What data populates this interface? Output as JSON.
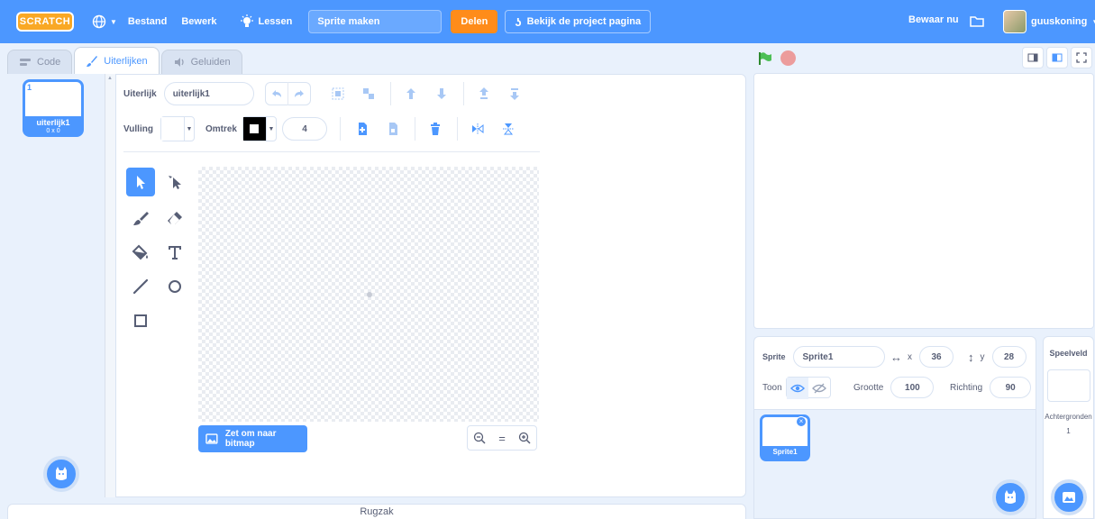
{
  "menubar": {
    "logo": "SCRATCH",
    "file_label": "Bestand",
    "edit_label": "Bewerk",
    "tutorials_label": "Lessen",
    "project_title": "Sprite maken",
    "share_label": "Delen",
    "project_page_label": "Bekijk de project pagina",
    "save_now_label": "Bewaar nu",
    "username": "guuskoning",
    "accent_color": "#4c97ff",
    "share_color": "#ff8c1a"
  },
  "tabs": [
    {
      "label": "Code",
      "icon": "code-icon"
    },
    {
      "label": "Uiterlijken",
      "icon": "brush-icon"
    },
    {
      "label": "Geluiden",
      "icon": "sound-icon"
    }
  ],
  "costumes": [
    {
      "index": "1",
      "name": "uiterlijk1",
      "size": "0 x 0"
    }
  ],
  "paint": {
    "costume_label": "Uiterlijk",
    "costume_name": "uiterlijk1",
    "fill_label": "Vulling",
    "stroke_label": "Omtrek",
    "stroke_width": "4",
    "fill_color": "#ffffff",
    "stroke_color": "#000000",
    "convert_label": "Zet om naar bitmap",
    "zoom_reset": "="
  },
  "backpack_label": "Rugzak",
  "sprite": {
    "sprite_label": "Sprite",
    "name": "Sprite1",
    "x_label": "x",
    "x": "36",
    "y_label": "y",
    "y": "28",
    "show_label": "Toon",
    "size_label": "Grootte",
    "size": "100",
    "direction_label": "Richting",
    "direction": "90"
  },
  "sprites": [
    {
      "name": "Sprite1"
    }
  ],
  "stage_selector": {
    "title": "Speelveld",
    "backdrops_label": "Achtergronden",
    "backdrops_count": "1"
  }
}
